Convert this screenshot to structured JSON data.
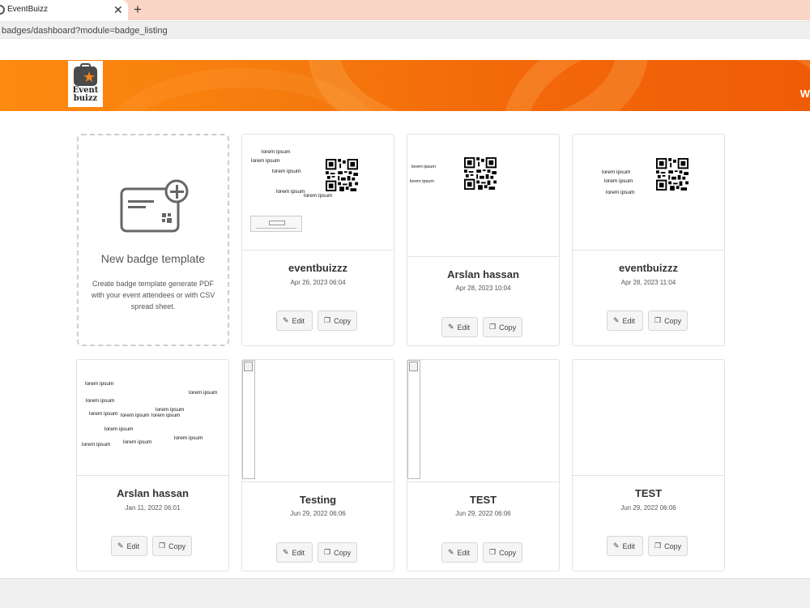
{
  "browser": {
    "tab_title": "EventBuizz",
    "tab_close": "✕",
    "new_tab": "+",
    "url": "badges/dashboard?module=badge_listing"
  },
  "header": {
    "logo_line1": "Event",
    "logo_line2": "buizz",
    "right_text": "W",
    "colors": {
      "accent": "#f57b0d"
    }
  },
  "new_template": {
    "title": "New badge template",
    "description": "Create badge template generate PDF with your event attendees or with CSV spread sheet."
  },
  "buttons": {
    "edit": "Edit",
    "copy": "Copy"
  },
  "lorem": "lorem ipsum",
  "cards": [
    {
      "title": "eventbuizzz",
      "date": "Apr 26, 2023 06:04"
    },
    {
      "title": "Arslan hassan",
      "date": "Apr 28, 2023 10:04"
    },
    {
      "title": "eventbuizzz",
      "date": "Apr 28, 2023 11:04"
    },
    {
      "title": "Arslan hassan",
      "date": "Jan 11, 2022 06:01"
    },
    {
      "title": "Testing",
      "date": "Jun 29, 2022 06:06"
    },
    {
      "title": "TEST",
      "date": "Jun 29, 2022 06:06"
    },
    {
      "title": "TEST",
      "date": "Jun 29, 2022 06:06"
    }
  ]
}
